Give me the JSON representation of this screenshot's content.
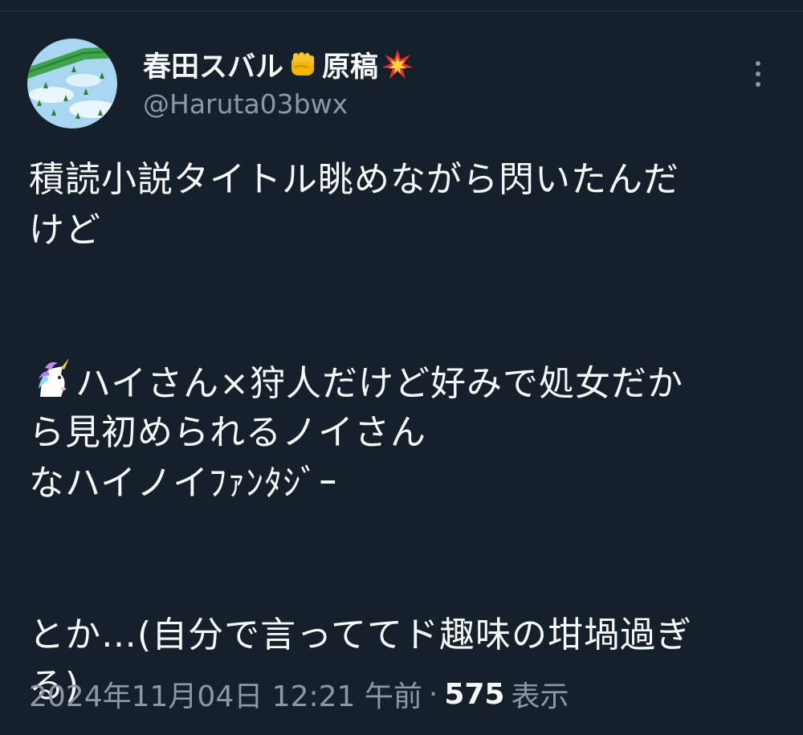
{
  "author": {
    "display_name_part1": "春田スバル",
    "emoji_1": "fist-emoji",
    "display_name_part2": "原稿",
    "emoji_2": "collision-emoji",
    "handle": "@Haruta03bwx",
    "avatar_icon": "avatar-image"
  },
  "more_icon": "more-options-icon",
  "tweet": {
    "lines": [
      "積読小説タイトル眺めながら閃いたんだ",
      "けど",
      "",
      "",
      "ハイさん×狩人だけど好みで処女だか",
      "ら見初められるノイさん",
      "なハイノイﾌｧﾝﾀｼﾞｰ",
      "",
      "",
      "とか…(自分で言っててド趣味の坩堝過ぎ",
      "る)"
    ],
    "unicorn_icon": "unicorn-emoji"
  },
  "meta": {
    "timestamp": "2024年11月04日 12:21 午前",
    "separator": "·",
    "views_count": "575",
    "views_label": "表示"
  },
  "colors": {
    "background": "#15202b",
    "primary_text": "#f7f9f9",
    "secondary_text": "#8b98a5"
  }
}
